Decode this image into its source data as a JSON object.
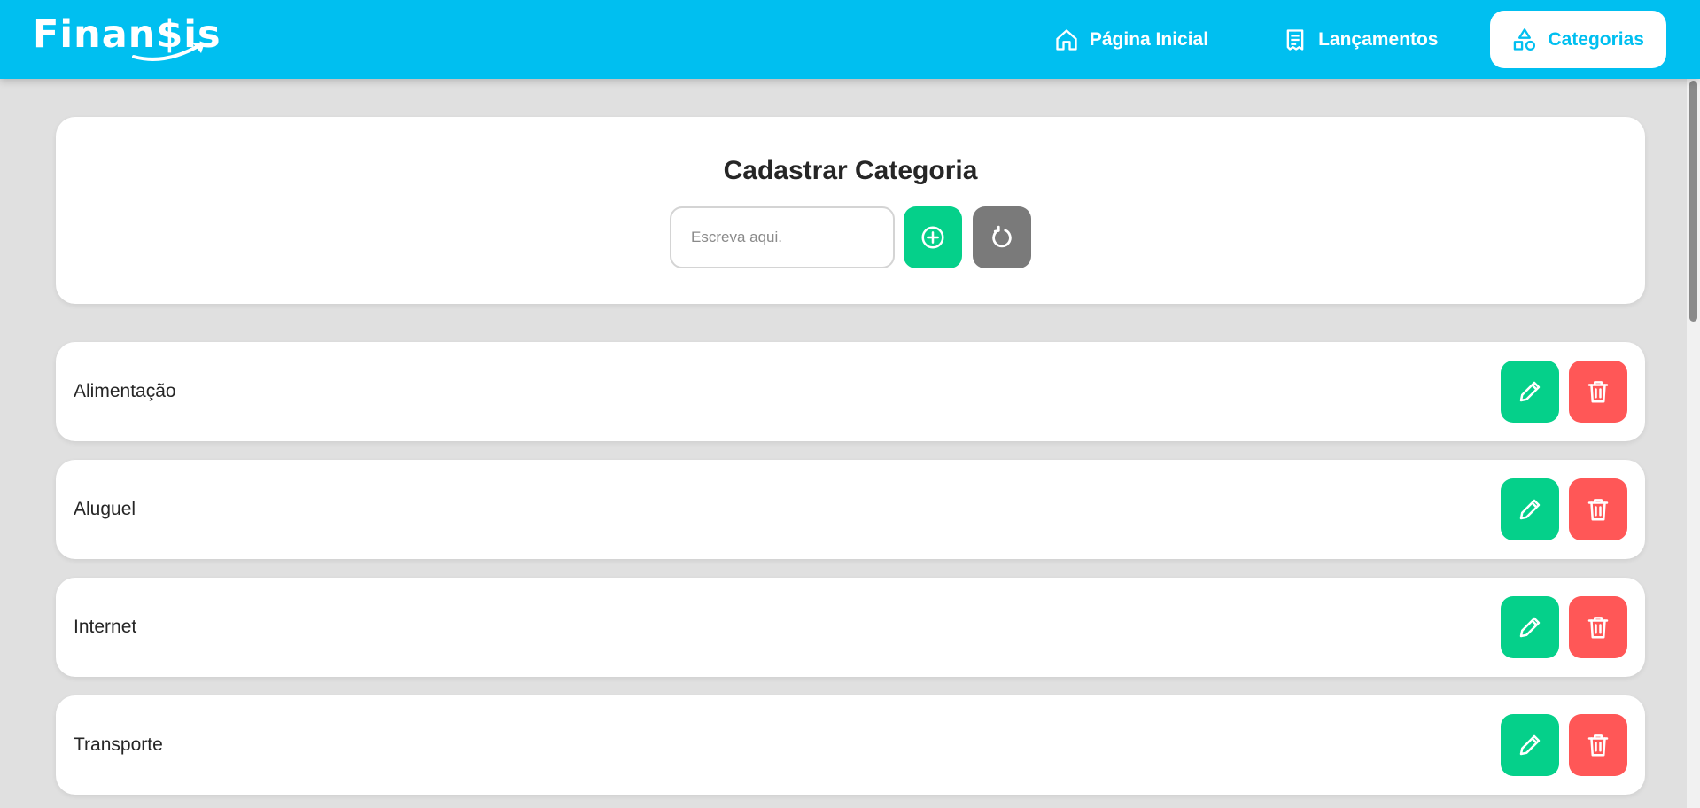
{
  "app": {
    "logo_text": "Finan$is"
  },
  "nav": {
    "items": [
      {
        "label": "Página Inicial",
        "icon": "home-icon",
        "active": false
      },
      {
        "label": "Lançamentos",
        "icon": "receipt-icon",
        "active": false
      },
      {
        "label": "Categorias",
        "icon": "shapes-icon",
        "active": true
      }
    ]
  },
  "form": {
    "title": "Cadastrar Categoria",
    "input_placeholder": "Escreva aqui.",
    "input_value": "",
    "add_icon": "plus-circle-icon",
    "reset_icon": "refresh-icon"
  },
  "categories": [
    {
      "name": "Alimentação"
    },
    {
      "name": "Aluguel"
    },
    {
      "name": "Internet"
    },
    {
      "name": "Transporte"
    }
  ],
  "colors": {
    "header": "#00bff0",
    "background": "#e0e0e0",
    "green": "#05d08a",
    "red": "#ff5757",
    "gray": "#7a7a7a"
  }
}
